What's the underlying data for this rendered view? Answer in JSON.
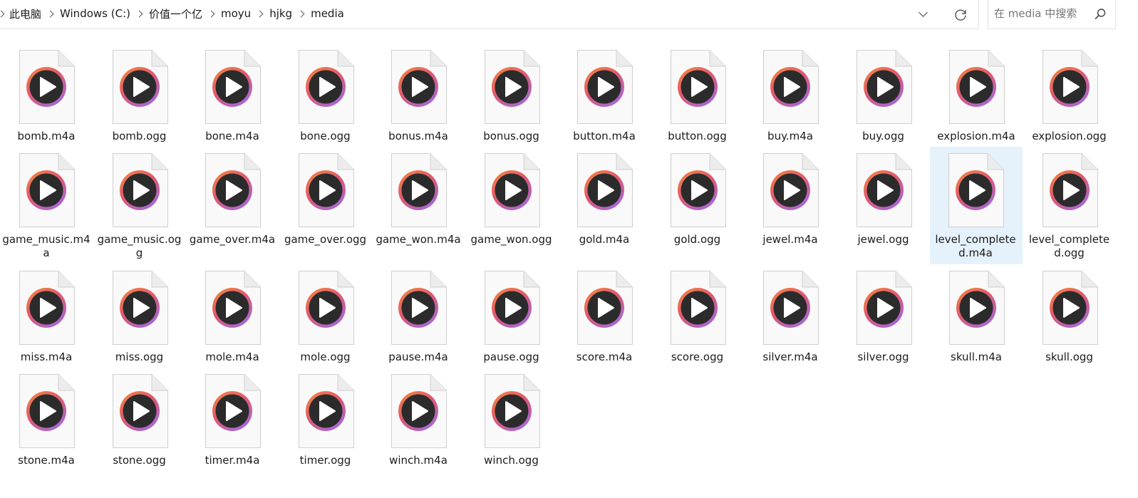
{
  "address": {
    "crumbs": [
      "此电脑",
      "Windows (C:)",
      "价值一个亿",
      "moyu",
      "hjkg",
      "media"
    ]
  },
  "search": {
    "placeholder": "在 media 中搜索"
  },
  "files": [
    "bomb.m4a",
    "bomb.ogg",
    "bone.m4a",
    "bone.ogg",
    "bonus.m4a",
    "bonus.ogg",
    "button.m4a",
    "button.ogg",
    "buy.m4a",
    "buy.ogg",
    "explosion.m4a",
    "explosion.ogg",
    "game_music.m4a",
    "game_music.ogg",
    "game_over.m4a",
    "game_over.ogg",
    "game_won.m4a",
    "game_won.ogg",
    "gold.m4a",
    "gold.ogg",
    "jewel.m4a",
    "jewel.ogg",
    "level_completed.m4a",
    "level_completed.ogg",
    "miss.m4a",
    "miss.ogg",
    "mole.m4a",
    "mole.ogg",
    "pause.m4a",
    "pause.ogg",
    "score.m4a",
    "score.ogg",
    "silver.m4a",
    "silver.ogg",
    "skull.m4a",
    "skull.ogg",
    "stone.m4a",
    "stone.ogg",
    "timer.m4a",
    "timer.ogg",
    "winch.m4a",
    "winch.ogg"
  ],
  "selected_file": "level_completed.m4a",
  "icon": {
    "name": "media-file-icon",
    "ring_colors": [
      "#f58a3c",
      "#e2586d",
      "#a768d6"
    ],
    "disc_color": "#2b2b2b"
  }
}
